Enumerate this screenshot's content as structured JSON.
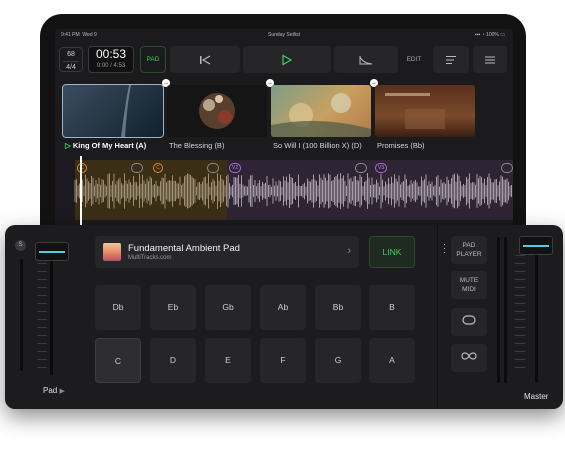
{
  "status_bar": {
    "time": "9:41 PM",
    "date": "Wed 9",
    "title": "Sunday Setlist",
    "battery": "100%"
  },
  "transport": {
    "bpm": "68",
    "time_signature": "4/4",
    "clock_main": "00:53",
    "clock_sub": "0:00 / 4:53",
    "pad_label": "PAD",
    "edit_label": "EDIT"
  },
  "setlist": [
    {
      "title": "King Of My Heart (A)",
      "current": true,
      "cover_text": "",
      "colors": [
        "#2b3a4a",
        "#12202c"
      ]
    },
    {
      "title": "The Blessing (B)",
      "current": false,
      "cover_text": "",
      "colors": [
        "#1a1a1a",
        "#3a2a20"
      ]
    },
    {
      "title": "So Will I (100 Billion X) (D)",
      "current": false,
      "cover_text": "",
      "colors": [
        "#6e8c6c",
        "#c9a060"
      ]
    },
    {
      "title": "Promises (Bb)",
      "current": false,
      "cover_text": "",
      "colors": [
        "#6a3a22",
        "#3a1e12"
      ]
    }
  ],
  "waveform": {
    "markers": [
      {
        "label": "C",
        "kind": "c"
      },
      {
        "label": "",
        "kind": "l"
      },
      {
        "label": "C",
        "kind": "c"
      },
      {
        "label": "",
        "kind": "l"
      },
      {
        "label": "V2",
        "kind": "v"
      },
      {
        "label": "",
        "kind": "l"
      },
      {
        "label": "V3",
        "kind": "v"
      },
      {
        "label": "",
        "kind": "l"
      }
    ]
  },
  "pad_player": {
    "s_label": "S",
    "pad_name": "Fundamental Ambient Pad",
    "pad_source": "MultiTracks.com",
    "link_label": "LINK",
    "keys": [
      "Db",
      "Eb",
      "Gb",
      "Ab",
      "Bb",
      "B",
      "C",
      "D",
      "E",
      "F",
      "G",
      "A"
    ],
    "active_key": "C",
    "channel_label": "Pad",
    "master_label": "Master",
    "side_buttons": {
      "pad_player_line1": "PAD",
      "pad_player_line2": "PLAYER",
      "mute_line1": "MUTE",
      "mute_line2": "MIDI"
    }
  }
}
